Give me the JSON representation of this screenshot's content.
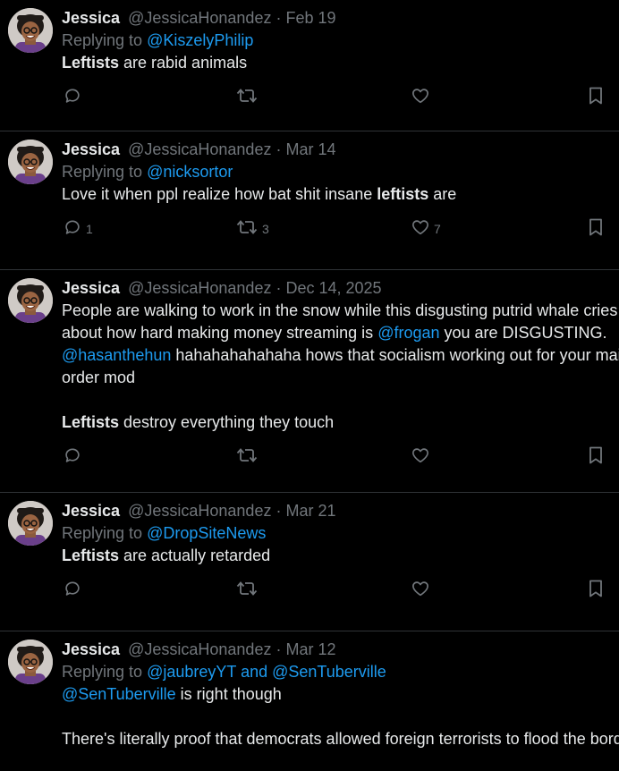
{
  "tweets": [
    {
      "name": "Jessica",
      "handle": "@JessicaHonandez",
      "sep": "·",
      "date": "Feb 19",
      "replying_prefix": "Replying to",
      "replying_to": "@KiszelyPhilip",
      "text_parts": [
        {
          "t": "Leftists",
          "bold": true
        },
        {
          "t": " are rabid animals"
        }
      ],
      "counts": {
        "reply": "",
        "retweet": "",
        "like": ""
      }
    },
    {
      "name": "Jessica",
      "handle": "@JessicaHonandez",
      "sep": "·",
      "date": "Mar 14",
      "replying_prefix": "Replying to",
      "replying_to": "@nicksortor",
      "text_parts": [
        {
          "t": "Love it when ppl realize how bat shit insane "
        },
        {
          "t": "leftists",
          "bold": true
        },
        {
          "t": " are"
        }
      ],
      "counts": {
        "reply": "1",
        "retweet": "3",
        "like": "7"
      }
    },
    {
      "name": "Jessica",
      "handle": "@JessicaHonandez",
      "sep": "·",
      "date": "Dec 14, 2025",
      "replying_prefix": "",
      "replying_to": "",
      "text_parts": [
        {
          "t": "People are walking to work in the snow while this disgusting putrid whale cries about how hard making money streaming is "
        },
        {
          "t": "@frogan",
          "mention": true
        },
        {
          "t": " you are DISGUSTING. "
        },
        {
          "t": "@hasanthehun",
          "mention": true
        },
        {
          "t": " hahahahahahaha hows that socialism working out for your mail order mod\n\n"
        },
        {
          "t": "Leftists",
          "bold": true
        },
        {
          "t": " destroy everything they touch"
        }
      ],
      "counts": {
        "reply": "",
        "retweet": "",
        "like": ""
      }
    },
    {
      "name": "Jessica",
      "handle": "@JessicaHonandez",
      "sep": "·",
      "date": "Mar 21",
      "replying_prefix": "Replying to",
      "replying_to": "@DropSiteNews",
      "text_parts": [
        {
          "t": "Leftists",
          "bold": true
        },
        {
          "t": " are actually retarded"
        }
      ],
      "counts": {
        "reply": "",
        "retweet": "",
        "like": ""
      }
    },
    {
      "name": "Jessica",
      "handle": "@JessicaHonandez",
      "sep": "·",
      "date": "Mar 12",
      "replying_prefix": "Replying to",
      "replying_to": "@jaubreyYT and @SenTuberville",
      "text_parts": [
        {
          "t": "@SenTuberville",
          "mention": true
        },
        {
          "t": " is right though\n\nThere's literally proof that democrats allowed foreign terrorists to flood the border"
        }
      ],
      "counts": {
        "reply": "",
        "retweet": "",
        "like": ""
      },
      "partial": true
    }
  ],
  "colors": {
    "background": "#000000",
    "text": "#e7e9ea",
    "muted": "#71767b",
    "mention": "#1d9bf0",
    "divider": "#2f3336"
  },
  "icons": [
    "reply-icon",
    "retweet-icon",
    "like-icon",
    "bookmark-icon",
    "avatar"
  ]
}
